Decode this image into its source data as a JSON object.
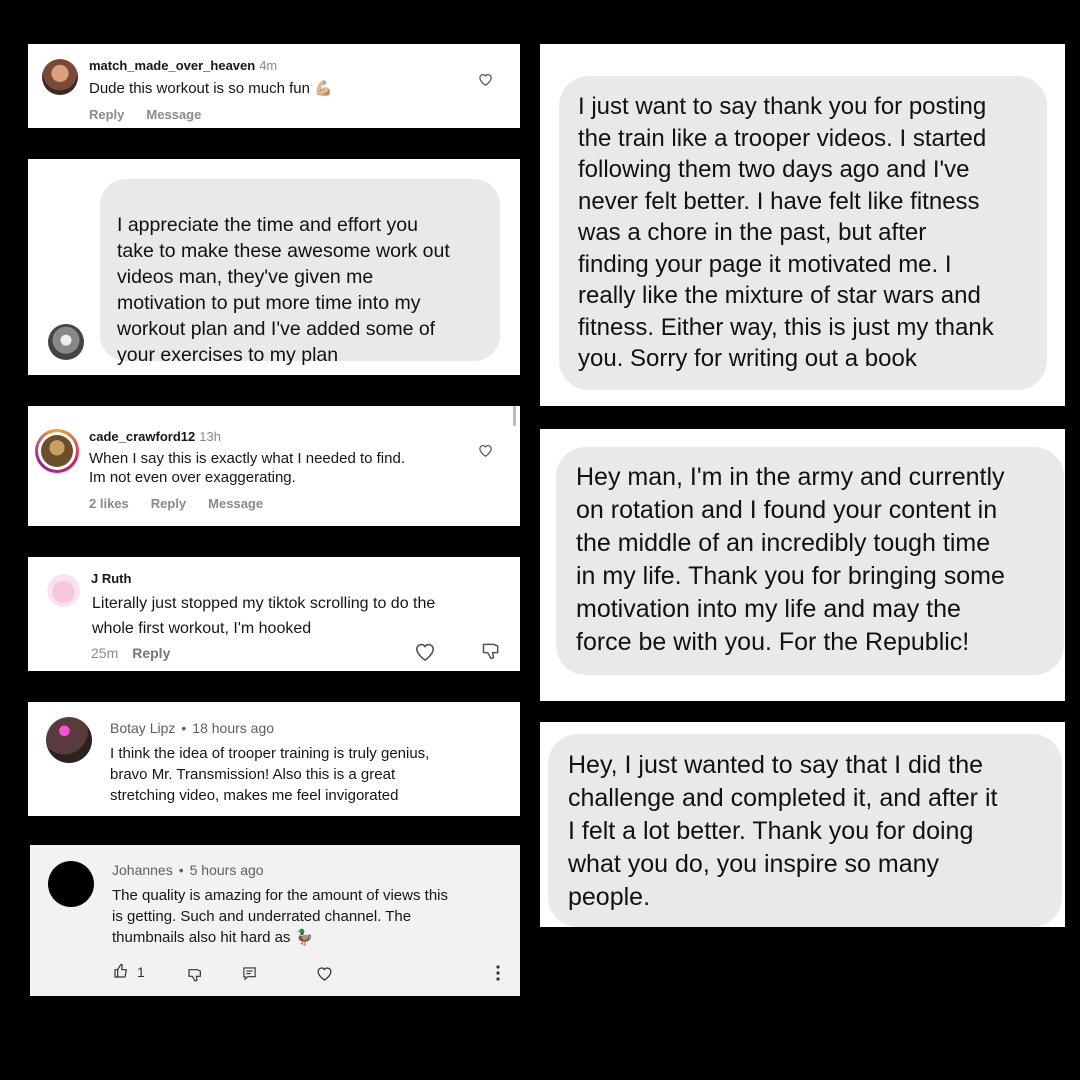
{
  "comments": [
    {
      "username": "match_made_over_heaven",
      "time": "4m",
      "text": "Dude this workout is so much fun",
      "emoji": "💪🏼",
      "actions": [
        "Reply",
        "Message"
      ]
    },
    {
      "text": "I appreciate the time and effort you\ntake to make these awesome work out\nvideos man, they've given me\nmotivation to put more time into my\nworkout plan and I've added some of\nyour exercises to my plan"
    },
    {
      "username": "cade_crawford12",
      "time": "13h",
      "text": "When I say this is exactly what I needed to find.\nIm not even over exaggerating.",
      "actions": [
        "2 likes",
        "Reply",
        "Message"
      ]
    },
    {
      "username": "J Ruth",
      "text": "Literally just stopped my tiktok scrolling to do the\nwhole first workout, I'm hooked",
      "time": "25m",
      "actions": [
        "Reply"
      ]
    },
    {
      "username": "Botay Lipz",
      "separator": "•",
      "time": "18 hours ago",
      "text": "I think the idea of trooper training is truly genius,\nbravo Mr. Transmission! Also this is a great\nstretching video, makes me feel invigorated"
    },
    {
      "username": "Johannes",
      "separator": "•",
      "time": "5 hours ago",
      "text": "The quality is amazing for the amount of views this\nis getting. Such and underrated channel. The\nthumbnails also hit hard as",
      "emoji": "🦆",
      "like_count": "1"
    }
  ],
  "messages": [
    {
      "text": "I just want to say thank you for posting\nthe train like a trooper videos. I started\nfollowing them two days ago and I've\nnever felt better. I have felt like fitness\nwas a chore in the past, but after\nfinding your page it motivated me. I\nreally like the mixture of star wars and\nfitness. Either way, this is just my thank\nyou. Sorry for writing out a book"
    },
    {
      "text": "Hey man, I'm in the army and currently\non rotation and I found your content in\nthe middle of an incredibly tough time\nin my life. Thank you for bringing some\nmotivation into my life and may the\nforce be with you. For the Republic!"
    },
    {
      "text": "Hey, I just wanted to say that I did the\nchallenge and completed it, and after it\nI felt a lot better. Thank you for doing\nwhat you do, you inspire so many\npeople."
    }
  ],
  "icons": {
    "heart": "heart-icon",
    "dislike": "thumbs-down-icon",
    "like": "thumbs-up-icon",
    "reply": "reply-icon",
    "more": "more-vertical-icon"
  },
  "colors": {
    "background": "#000000",
    "card": "#ffffff",
    "bubble": "#e9e9eb",
    "muted": "#8a8a8a"
  }
}
